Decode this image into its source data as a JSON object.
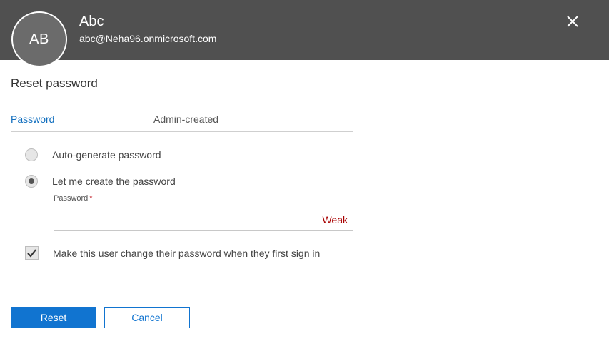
{
  "header": {
    "avatar_initials": "AB",
    "user_name": "Abc",
    "user_email": "abc@Neha96.onmicrosoft.com",
    "close_icon": "close-icon",
    "background_color": "#505050"
  },
  "panel": {
    "title": "Reset password"
  },
  "tabs": [
    {
      "label": "Password",
      "active": true
    },
    {
      "label": "Admin-created",
      "active": false
    }
  ],
  "options": {
    "auto_generate_label": "Auto-generate password",
    "auto_generate_selected": false,
    "create_label": "Let me create the password",
    "create_selected": true
  },
  "password_field": {
    "label": "Password",
    "required_mark": "*",
    "value": "",
    "strength": "Weak"
  },
  "change_on_signin": {
    "label": "Make this user change their password when they first sign in",
    "checked": true
  },
  "buttons": {
    "reset_label": "Reset",
    "cancel_label": "Cancel"
  },
  "colors": {
    "accent": "#1174d0",
    "link": "#106ebe",
    "weak": "#a80000",
    "required": "#c4262e"
  }
}
